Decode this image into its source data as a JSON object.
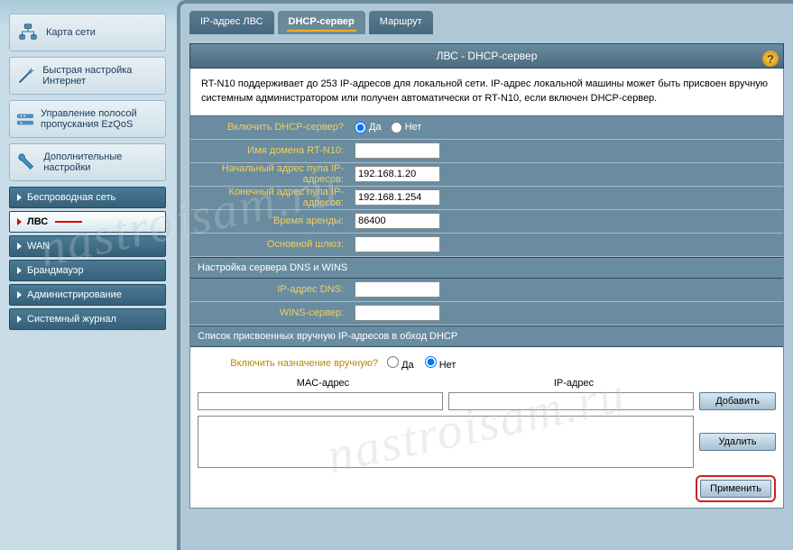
{
  "sidebar": {
    "top": {
      "network_map": "Карта сети",
      "quick_setup": "Быстрая настройка Интернет",
      "ezqos": "Управление полосой пропускания EzQoS",
      "advanced": "Дополнительные настройки"
    },
    "items": [
      {
        "label": "Беспроводная сеть"
      },
      {
        "label": "ЛВС"
      },
      {
        "label": "WAN"
      },
      {
        "label": "Брандмауэр"
      },
      {
        "label": "Администрирование"
      },
      {
        "label": "Системный журнал"
      }
    ]
  },
  "tabs": [
    {
      "label": "IP-адрес ЛВС"
    },
    {
      "label": "DHCP-сервер"
    },
    {
      "label": "Маршрут"
    }
  ],
  "panel": {
    "title": "ЛВС - DHCP-сервер",
    "intro": "RT-N10 поддерживает до 253 IP-адресов для локальной сети. IP-адрес локальной машины может быть присвоен вручную системным администратором или получен автоматически от RT-N10, если включен DHCP-сервер.",
    "enable_label": "Включить DHCP-сервер?",
    "yes": "Да",
    "no": "Нет",
    "domain_label": "Имя домена RT-N10:",
    "domain_value": "",
    "start_label": "Начальный адрес пула IP-адресов:",
    "start_value": "192.168.1.20",
    "end_label": "Конечный адрес пула IP-адресов:",
    "end_value": "192.168.1.254",
    "lease_label": "Время аренды:",
    "lease_value": "86400",
    "gateway_label": "Основной шлюз:",
    "gateway_value": "",
    "dns_header": "Настройка сервера DNS и WINS",
    "dns_label": "IP-адрес DNS:",
    "dns_value": "",
    "wins_label": "WINS-сервер:",
    "wins_value": "",
    "manual_header": "Список присвоенных вручную IP-адресов в обход DHCP",
    "manual_label": "Включить назначение вручную?",
    "mac_col": "MAC-адрес",
    "ip_col": "IP-адрес",
    "add_btn": "Добавить",
    "del_btn": "Удалить",
    "apply_btn": "Применить"
  },
  "watermark": "nastroisam.ru"
}
